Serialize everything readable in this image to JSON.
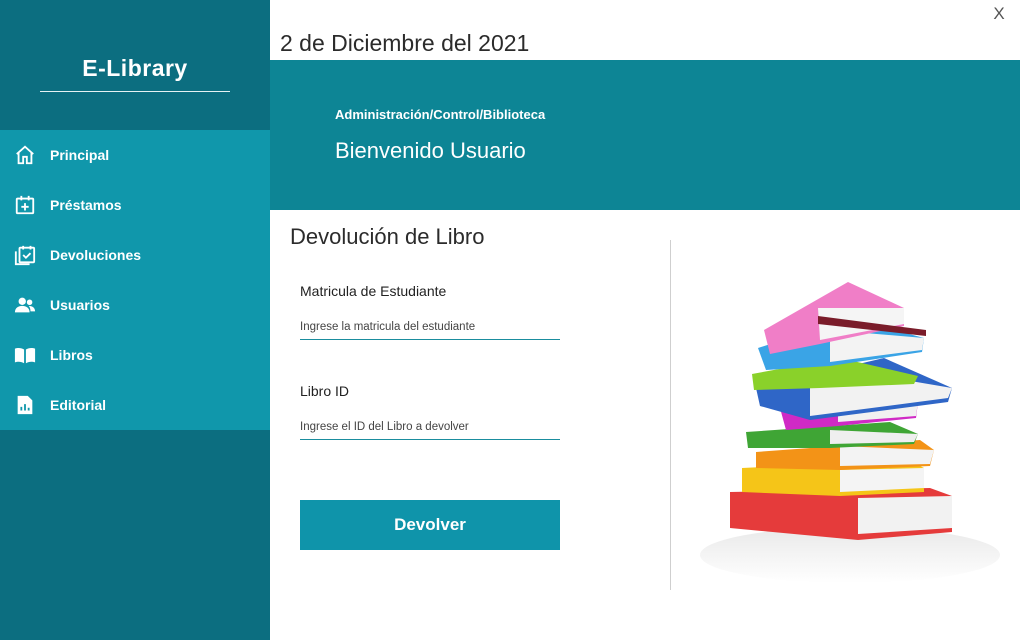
{
  "window": {
    "close_label": "X"
  },
  "sidebar": {
    "brand": "E-Library",
    "items": [
      {
        "label": "Principal",
        "icon": "home-icon"
      },
      {
        "label": "Préstamos",
        "icon": "calendar-plus-icon"
      },
      {
        "label": "Devoluciones",
        "icon": "calendar-check-icon"
      },
      {
        "label": "Usuarios",
        "icon": "users-icon"
      },
      {
        "label": "Libros",
        "icon": "book-open-icon"
      },
      {
        "label": "Editorial",
        "icon": "report-icon"
      }
    ]
  },
  "header": {
    "date": "2 de Diciembre del 2021",
    "breadcrumb": "Administración/Control/Biblioteca",
    "welcome": "Bienvenido Usuario"
  },
  "form": {
    "title": "Devolución de Libro",
    "fields": [
      {
        "label": "Matricula de Estudiante",
        "placeholder": "Ingrese la matricula del estudiante",
        "value": ""
      },
      {
        "label": "Libro ID",
        "placeholder": "Ingrese el ID del Libro a devolver",
        "value": ""
      }
    ],
    "submit_label": "Devolver"
  },
  "colors": {
    "sidebar_dark": "#0c6e80",
    "sidebar_menu": "#1097ab",
    "banner": "#0d8595",
    "button": "#0f94aa"
  }
}
